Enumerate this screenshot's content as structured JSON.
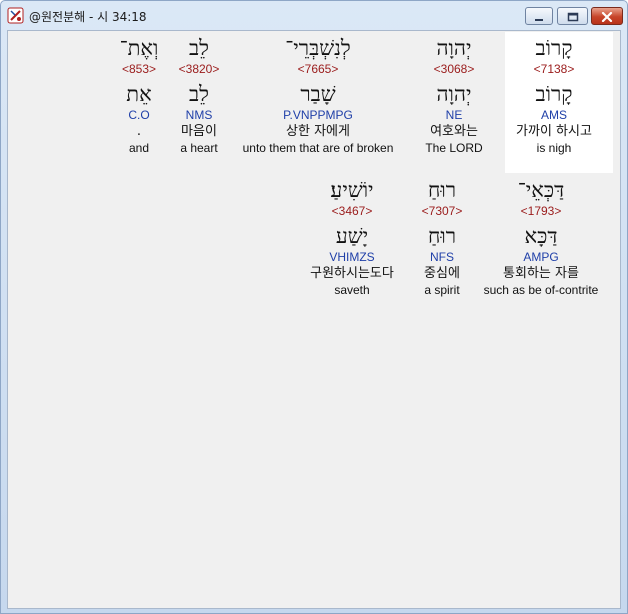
{
  "window": {
    "title": "@원전분해 - 시 34:18",
    "controls": {
      "minimize": "minimize-icon",
      "maximize": "maximize-icon",
      "close": "close-icon"
    },
    "colors": {
      "strong_number": "#9a1b1b",
      "grammar_code": "#1f3fa8",
      "highlight": "#ffffff",
      "close_button": "#c7452a"
    }
  },
  "verse": {
    "rows": [
      {
        "words": [
          {
            "hebrew": "קָרוֹב",
            "strong": "<7138>",
            "lemma": "קָרוֹב",
            "code": "AMS",
            "korean": "가까이 하시고",
            "english": "is nigh",
            "selected": true
          },
          {
            "hebrew": "יְהוָה",
            "strong": "<3068>",
            "lemma": "יְהוָה",
            "code": "NE",
            "korean": "여호와는",
            "english": "The LORD",
            "selected": false
          },
          {
            "hebrew": "לְנִשְׁבְּרֵי־",
            "strong": "<7665>",
            "lemma": "שָׁבַר",
            "code": "P.VNPPMPG",
            "korean": "상한 자에게",
            "english": "unto them that are of broken",
            "selected": false
          },
          {
            "hebrew": "לֵב",
            "strong": "<3820>",
            "lemma": "לֵב",
            "code": "NMS",
            "korean": "마음이",
            "english": "a heart",
            "selected": false
          },
          {
            "hebrew": "וְאֶת־",
            "strong": "<853>",
            "lemma": "אֵת",
            "code": "C.O",
            "korean": ".",
            "english": "and",
            "selected": false
          }
        ]
      },
      {
        "words": [
          {
            "hebrew": "דַּכְּאֵי־",
            "strong": "<1793>",
            "lemma": "דַּכָּא",
            "code": "AMPG",
            "korean": "통회하는 자를",
            "english": "such as be of-contrite",
            "selected": false
          },
          {
            "hebrew": "רוּחַ",
            "strong": "<7307>",
            "lemma": "רוּחַ",
            "code": "NFS",
            "korean": "중심에",
            "english": "a spirit",
            "selected": false
          },
          {
            "hebrew": "יוֹשִׁיעַ׃",
            "strong": "<3467>",
            "lemma": "יָשַׁע",
            "code": "VHIMZS",
            "korean": "구원하시는도다",
            "english": "saveth",
            "selected": false
          }
        ]
      }
    ]
  }
}
